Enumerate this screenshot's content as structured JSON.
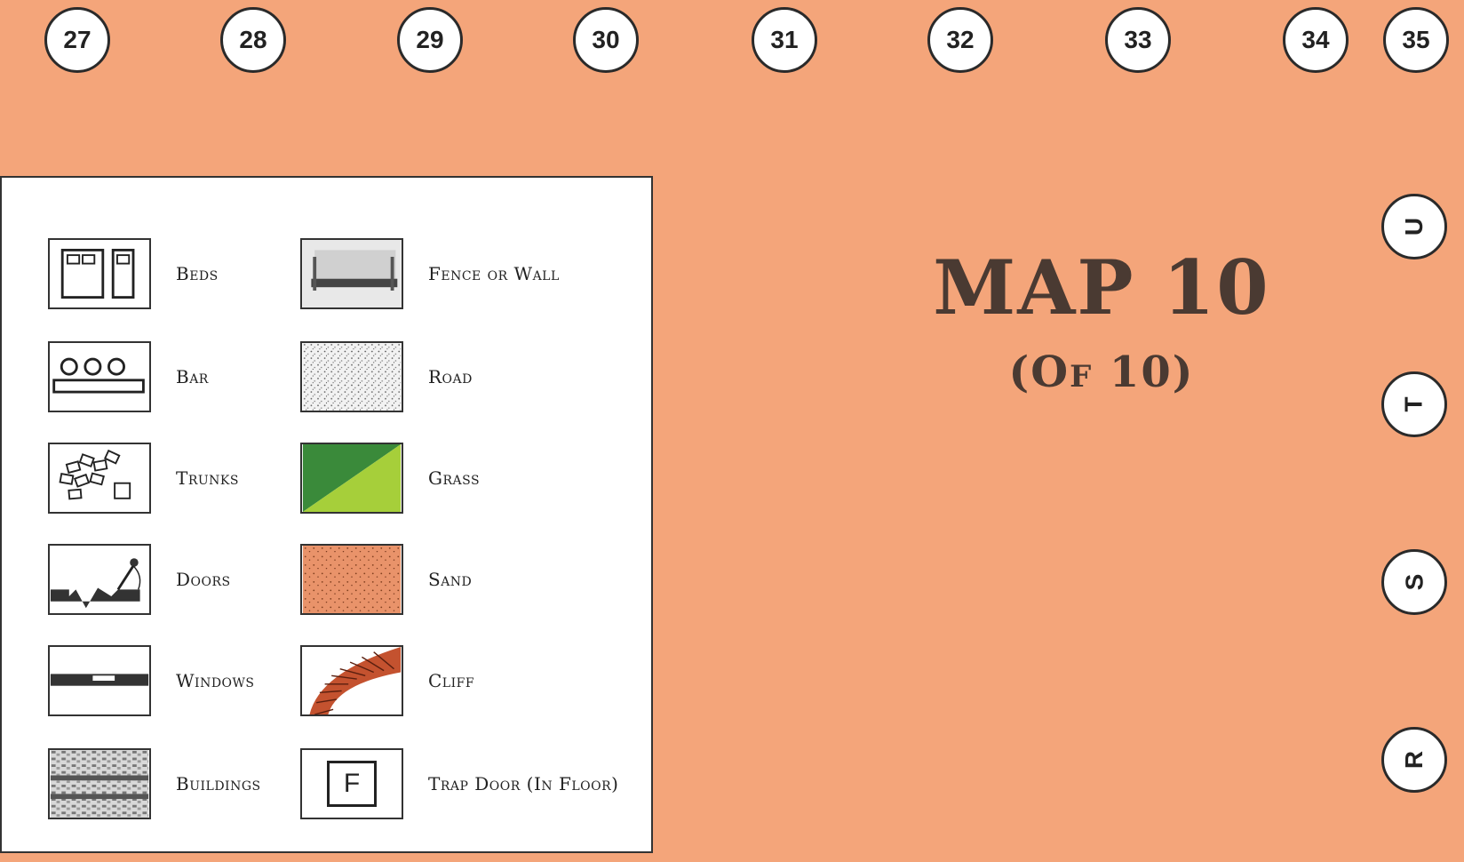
{
  "column_markers": [
    "27",
    "28",
    "29",
    "30",
    "31",
    "32",
    "33",
    "34",
    "35"
  ],
  "row_markers": [
    "U",
    "T",
    "S",
    "R"
  ],
  "title": "MAP 10",
  "subtitle": "(Of 10)",
  "legend": [
    {
      "label": "Beds",
      "icon": "beds-icon"
    },
    {
      "label": "Fence or Wall",
      "icon": "fence-wall-icon"
    },
    {
      "label": "Bar",
      "icon": "bar-icon"
    },
    {
      "label": "Road",
      "icon": "road-icon"
    },
    {
      "label": "Trunks",
      "icon": "trunks-icon"
    },
    {
      "label": "Grass",
      "icon": "grass-icon"
    },
    {
      "label": "Doors",
      "icon": "doors-icon"
    },
    {
      "label": "Sand",
      "icon": "sand-icon"
    },
    {
      "label": "Windows",
      "icon": "windows-icon"
    },
    {
      "label": "Cliff",
      "icon": "cliff-icon"
    },
    {
      "label": "Buildings",
      "icon": "buildings-icon"
    },
    {
      "label": "Trap Door (In Floor)",
      "icon": "trap-door-icon",
      "symbol": "F"
    }
  ],
  "colors": {
    "background": "#f4a57a",
    "title": "#4a3a32",
    "grass_dark": "#3a8a3a",
    "grass_light": "#a6cf3a",
    "sand": "#e9936a",
    "cliff": "#c4522f"
  }
}
